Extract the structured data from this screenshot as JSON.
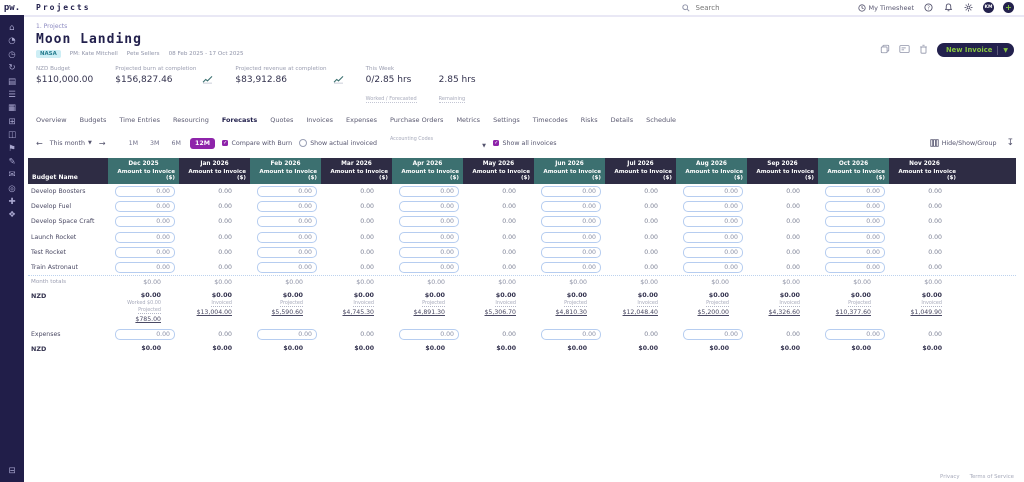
{
  "topbar": {
    "logo": "pw.",
    "app_title": "Projects",
    "search_placeholder": "Search",
    "my_timesheet": "My Timesheet",
    "avatar_initials": "KM"
  },
  "sidebar": {
    "items": [
      {
        "name": "home",
        "glyph": "⌂"
      },
      {
        "name": "dashboard",
        "glyph": "◔"
      },
      {
        "name": "time",
        "glyph": "◷"
      },
      {
        "name": "history",
        "glyph": "↻"
      },
      {
        "name": "projects",
        "glyph": "▤"
      },
      {
        "name": "tasks",
        "glyph": "☰"
      },
      {
        "name": "modules",
        "glyph": "▦"
      },
      {
        "name": "boards",
        "glyph": "⊞"
      },
      {
        "name": "invoices",
        "glyph": "◫"
      },
      {
        "name": "milestones",
        "glyph": "⚑"
      },
      {
        "name": "edit",
        "glyph": "✎"
      },
      {
        "name": "messages",
        "glyph": "✉"
      },
      {
        "name": "targets",
        "glyph": "◎"
      },
      {
        "name": "add",
        "glyph": "✚"
      },
      {
        "name": "apps",
        "glyph": "❖"
      }
    ],
    "bottom_item": {
      "name": "collapse",
      "glyph": "⊟"
    }
  },
  "project": {
    "breadcrumb": "1. Projects",
    "title": "Moon Landing",
    "tag": "NASA",
    "meta_pm": "PM: Kate Mitchell",
    "meta_owner": "Pete Sellers",
    "meta_dates": "08 Feb 2025 - 17 Oct 2025",
    "new_invoice_label": "New Invoice",
    "stats": {
      "budget_label": "NZD Budget",
      "budget_value": "$110,000.00",
      "burn_label": "Projected burn at completion",
      "burn_value": "$156,827.46",
      "revenue_label": "Projected revenue at completion",
      "revenue_value": "$83,912.86",
      "week_label": "This Week",
      "week_value": "0/2.85 hrs",
      "week_sub": "Worked / Forecasted",
      "remaining_value": "2.85 hrs",
      "remaining_sub": "Remaining"
    }
  },
  "tabs": {
    "items": [
      "Overview",
      "Budgets",
      "Time Entries",
      "Resourcing",
      "Forecasts",
      "Quotes",
      "Invoices",
      "Expenses",
      "Purchase Orders",
      "Metrics",
      "Settings",
      "Timecodes",
      "Risks",
      "Details",
      "Schedule"
    ],
    "active": "Forecasts"
  },
  "toolbar": {
    "period_label": "This month",
    "ranges": [
      "1M",
      "3M",
      "6M",
      "12M"
    ],
    "active_range": "12M",
    "compare_burn": "Compare with Burn",
    "show_actual": "Show actual invoiced",
    "accounting_codes_label": "Accounting Codes",
    "show_all": "Show all invoices",
    "hide_show_group": "Hide/Show/Group"
  },
  "table": {
    "first_col": "Budget Name",
    "subheader": "Amount to Invoice ($)",
    "months": [
      {
        "label": "Dec 2025",
        "editable": true
      },
      {
        "label": "Jan 2026",
        "editable": false
      },
      {
        "label": "Feb 2026",
        "editable": true
      },
      {
        "label": "Mar 2026",
        "editable": false
      },
      {
        "label": "Apr 2026",
        "editable": true
      },
      {
        "label": "May 2026",
        "editable": false
      },
      {
        "label": "Jun 2026",
        "editable": true
      },
      {
        "label": "Jul 2026",
        "editable": false
      },
      {
        "label": "Aug 2026",
        "editable": true
      },
      {
        "label": "Sep 2026",
        "editable": false
      },
      {
        "label": "Oct 2026",
        "editable": true
      },
      {
        "label": "Nov 2026",
        "editable": false
      }
    ],
    "rows": [
      {
        "name": "Develop Boosters",
        "values": [
          "0.00",
          "0.00",
          "0.00",
          "0.00",
          "0.00",
          "0.00",
          "0.00",
          "0.00",
          "0.00",
          "0.00",
          "0.00",
          "0.00"
        ]
      },
      {
        "name": "Develop Fuel",
        "values": [
          "0.00",
          "0.00",
          "0.00",
          "0.00",
          "0.00",
          "0.00",
          "0.00",
          "0.00",
          "0.00",
          "0.00",
          "0.00",
          "0.00"
        ]
      },
      {
        "name": "Develop Space Craft",
        "values": [
          "0.00",
          "0.00",
          "0.00",
          "0.00",
          "0.00",
          "0.00",
          "0.00",
          "0.00",
          "0.00",
          "0.00",
          "0.00",
          "0.00"
        ]
      },
      {
        "name": "Launch Rocket",
        "values": [
          "0.00",
          "0.00",
          "0.00",
          "0.00",
          "0.00",
          "0.00",
          "0.00",
          "0.00",
          "0.00",
          "0.00",
          "0.00",
          "0.00"
        ]
      },
      {
        "name": "Test Rocket",
        "values": [
          "0.00",
          "0.00",
          "0.00",
          "0.00",
          "0.00",
          "0.00",
          "0.00",
          "0.00",
          "0.00",
          "0.00",
          "0.00",
          "0.00"
        ]
      },
      {
        "name": "Train Astronaut",
        "values": [
          "0.00",
          "0.00",
          "0.00",
          "0.00",
          "0.00",
          "0.00",
          "0.00",
          "0.00",
          "0.00",
          "0.00",
          "0.00",
          "0.00"
        ]
      }
    ],
    "month_totals": {
      "label": "Month totals",
      "values": [
        "$0.00",
        "$0.00",
        "$0.00",
        "$0.00",
        "$0.00",
        "$0.00",
        "$0.00",
        "$0.00",
        "$0.00",
        "$0.00",
        "$0.00",
        "$0.00"
      ]
    },
    "nzd": {
      "label": "NZD",
      "totals": [
        "$0.00",
        "$0.00",
        "$0.00",
        "$0.00",
        "$0.00",
        "$0.00",
        "$0.00",
        "$0.00",
        "$0.00",
        "$0.00",
        "$0.00",
        "$0.00"
      ],
      "details": [
        {
          "extra": "Worked $0.00",
          "note": "Projected",
          "amount": "$785.00"
        },
        {
          "note": "Invoiced",
          "amount": "$13,004.00"
        },
        {
          "note": "Projected",
          "amount": "$5,590.60"
        },
        {
          "note": "Invoiced",
          "amount": "$4,745.30"
        },
        {
          "note": "Projected",
          "amount": "$4,891.30"
        },
        {
          "note": "Invoiced",
          "amount": "$5,306.70"
        },
        {
          "note": "Projected",
          "amount": "$4,810.30"
        },
        {
          "note": "Invoiced",
          "amount": "$12,048.40"
        },
        {
          "note": "Projected",
          "amount": "$5,200.00"
        },
        {
          "note": "Invoiced",
          "amount": "$4,326.60"
        },
        {
          "note": "Projected",
          "amount": "$10,377.60"
        },
        {
          "note": "Invoiced",
          "amount": "$1,049.90"
        }
      ]
    },
    "expenses": {
      "label": "Expenses",
      "values": [
        "0.00",
        "0.00",
        "0.00",
        "0.00",
        "0.00",
        "0.00",
        "0.00",
        "0.00",
        "0.00",
        "0.00",
        "0.00",
        "0.00"
      ]
    },
    "nzd_bottom": {
      "label": "NZD",
      "values": [
        "$0.00",
        "$0.00",
        "$0.00",
        "$0.00",
        "$0.00",
        "$0.00",
        "$0.00",
        "$0.00",
        "$0.00",
        "$0.00",
        "$0.00",
        "$0.00"
      ]
    }
  },
  "footer": {
    "links": [
      "Privacy",
      "Terms of Service"
    ]
  },
  "colors": {
    "navy": "#23214d",
    "teal": "#3c7070",
    "header_dark": "#2e2c44",
    "accent_purple": "#8e24aa",
    "accent_green": "#86c440"
  }
}
